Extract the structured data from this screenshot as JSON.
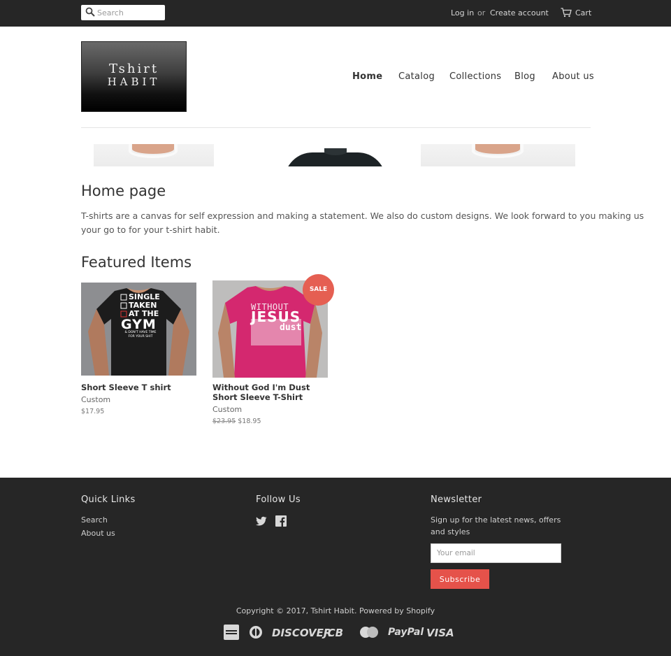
{
  "topbar": {
    "search_placeholder": "Search",
    "login": "Log in",
    "or": "or",
    "create_account": "Create account",
    "cart": "Cart"
  },
  "logo": {
    "line1": "Tshirt",
    "line2": "HABIT"
  },
  "nav": [
    {
      "label": "Home",
      "active": true
    },
    {
      "label": "Catalog",
      "active": false
    },
    {
      "label": "Collections",
      "active": false
    },
    {
      "label": "Blog",
      "active": false
    },
    {
      "label": "About us",
      "active": false
    }
  ],
  "main": {
    "page_title": "Home page",
    "intro": "T-shirts are a canvas for self expression and making a statement. We also do custom designs. We look forward to you making us your go to for your t-shirt habit.",
    "featured_title": "Featured Items",
    "products": [
      {
        "title": "Short Sleeve T shirt",
        "vendor": "Custom",
        "price": "$17.95",
        "shirt_color": "#1c1c1c",
        "image_text": [
          "SINGLE",
          "TAKEN",
          "AT THE",
          "GYM",
          "& DON'T HAVE TIME",
          "FOR YOUR SHIT"
        ]
      },
      {
        "title": "Without God I'm Dust Short Sleeve T-Shirt",
        "vendor": "Custom",
        "compare_price": "$23.95",
        "price": "$18.95",
        "badge": "SALE",
        "shirt_color": "#d4286f",
        "image_text": [
          "WITHOUT",
          "JESUS",
          "dust"
        ]
      }
    ]
  },
  "footer": {
    "quick_links_title": "Quick Links",
    "quick_links": [
      "Search",
      "About us"
    ],
    "follow_title": "Follow Us",
    "social_icons": [
      "twitter-icon",
      "facebook-icon"
    ],
    "newsletter_title": "Newsletter",
    "newsletter_text": "Sign up for the latest news, offers and styles",
    "email_placeholder": "Your email",
    "subscribe_label": "Subscribe",
    "copyright": "Copyright © 2017, Tshirt Habit. Powered by Shopify",
    "payment_icons": [
      "american-express-icon",
      "diners-club-icon",
      "discover-icon",
      "jcb-icon",
      "mastercard-icon",
      "paypal-icon",
      "visa-icon"
    ],
    "payment_labels": {
      "discover": "DISCOVER",
      "jcb": "JCB",
      "paypal": "PayPal",
      "visa": "VISA"
    }
  },
  "colors": {
    "topbar_bg": "#262626",
    "footer_bg": "#262626",
    "accent": "#e5524a",
    "sale_badge": "#e55f52"
  }
}
